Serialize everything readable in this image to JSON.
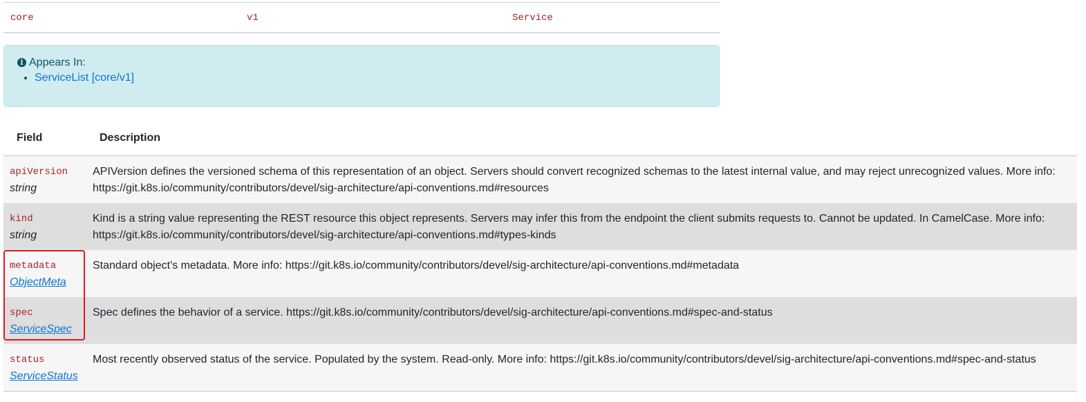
{
  "gvk": {
    "group": "core",
    "version": "v1",
    "kind": "Service"
  },
  "appears_in": {
    "title": "Appears In:",
    "info_icon": "info-circle-icon",
    "items": [
      {
        "label": "ServiceList [core/v1]"
      }
    ]
  },
  "table": {
    "headers": {
      "field": "Field",
      "description": "Description"
    },
    "rows": [
      {
        "name": "apiVersion",
        "type": "string",
        "type_is_link": false,
        "description": "APIVersion defines the versioned schema of this representation of an object. Servers should convert recognized schemas to the latest internal value, and may reject unrecognized values. More info: https://git.k8s.io/community/contributors/devel/sig-architecture/api-conventions.md#resources"
      },
      {
        "name": "kind",
        "type": "string",
        "type_is_link": false,
        "description": "Kind is a string value representing the REST resource this object represents. Servers may infer this from the endpoint the client submits requests to. Cannot be updated. In CamelCase. More info: https://git.k8s.io/community/contributors/devel/sig-architecture/api-conventions.md#types-kinds"
      },
      {
        "name": "metadata",
        "type": "ObjectMeta",
        "type_is_link": true,
        "description": "Standard object's metadata. More info: https://git.k8s.io/community/contributors/devel/sig-architecture/api-conventions.md#metadata"
      },
      {
        "name": "spec",
        "type": "ServiceSpec",
        "type_is_link": true,
        "description": "Spec defines the behavior of a service. https://git.k8s.io/community/contributors/devel/sig-architecture/api-conventions.md#spec-and-status"
      },
      {
        "name": "status",
        "type": "ServiceStatus",
        "type_is_link": true,
        "description": "Most recently observed status of the service. Populated by the system. Read-only. More info: https://git.k8s.io/community/contributors/devel/sig-architecture/api-conventions.md#spec-and-status"
      }
    ]
  },
  "colors": {
    "field_name": "#a3232b",
    "link": "#0b74d4",
    "highlight": "#e0181e"
  }
}
